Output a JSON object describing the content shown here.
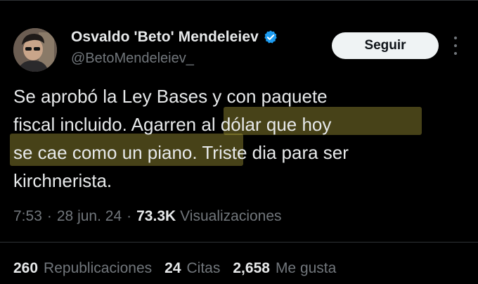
{
  "author": {
    "display_name": "Osvaldo 'Beto' Mendeleiev",
    "handle": "@BetoMendeleiev_",
    "verified_icon": "verified-badge-icon",
    "verified_color": "#1d9bf0"
  },
  "follow_button": {
    "label": "Seguir"
  },
  "more_icon": "more-vertical-icon",
  "tweet": {
    "lines": [
      "Se aprobó la Ley Bases y con paquete",
      "fiscal incluido. Agarren al dólar que hoy",
      "se cae como un piano. Triste dia para ser",
      "kirchnerista."
    ]
  },
  "meta": {
    "time": "7:53",
    "date": "28 jun. 24",
    "views_count": "73.3K",
    "views_label": "Visualizaciones"
  },
  "stats": {
    "reposts_count": "260",
    "reposts_label": "Republicaciones",
    "quotes_count": "24",
    "quotes_label": "Citas",
    "likes_count": "2,658",
    "likes_label": "Me gusta"
  },
  "colors": {
    "background": "#000000",
    "text": "#e7e9ea",
    "muted": "#71767b",
    "highlight": "#d8c84a"
  }
}
